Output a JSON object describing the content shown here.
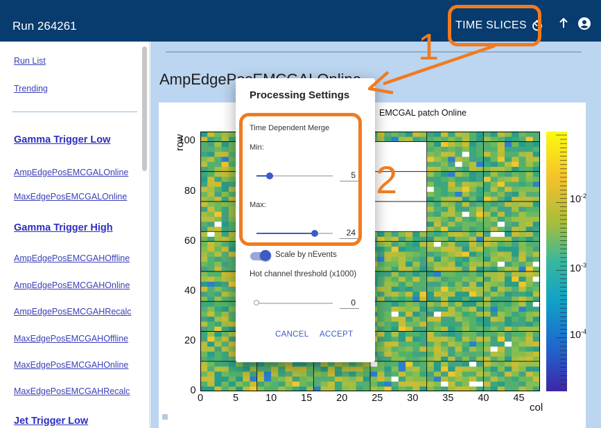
{
  "app": {
    "title": "Run 264261",
    "time_slices_label": "TIME SLICES"
  },
  "icons": {
    "timer": "timer-icon",
    "up": "arrow-up-icon",
    "account": "account-circle-icon"
  },
  "sidebar": {
    "links": [
      {
        "label": "Run List"
      },
      {
        "label": "Trending"
      }
    ],
    "groups": [
      {
        "heading": "Gamma Trigger Low",
        "items": [
          "AmpEdgePosEMCGALOnline",
          "MaxEdgePosEMCGALOnline"
        ]
      },
      {
        "heading": "Gamma Trigger High",
        "items": [
          "AmpEdgePosEMCGAHOffline",
          "AmpEdgePosEMCGAHOnline",
          "AmpEdgePosEMCGAHRecalc",
          "MaxEdgePosEMCGAHOffline",
          "MaxEdgePosEMCGAHOnline",
          "MaxEdgePosEMCGAHRecalc"
        ]
      },
      {
        "heading": "Jet Trigger Low",
        "items": []
      }
    ]
  },
  "main": {
    "title": "AmpEdgePosEMCGALOnline",
    "plot_title_visible": "EMCGAL patch Online"
  },
  "dialog": {
    "title": "Processing Settings",
    "merge_label": "Time Dependent Merge",
    "min_label": "Min:",
    "min_value": "5",
    "max_label": "Max:",
    "max_value": "24",
    "scale_label": "Scale by nEvents",
    "scale_enabled": true,
    "threshold_label": "Hot channel threshold (x1000)",
    "threshold_value": "0",
    "cancel_label": "CANCEL",
    "accept_label": "ACCEPT",
    "min_fraction": 0.17,
    "max_fraction": 0.76,
    "threshold_fraction": 0.0
  },
  "annotations": {
    "step1": "1",
    "step2": "2",
    "color": "#f07b1f"
  },
  "chart_data": {
    "type": "heatmap",
    "title": "EMCGAL patch Online",
    "xlabel": "col",
    "ylabel": "row",
    "xlim": [
      0,
      48
    ],
    "ylim": [
      0,
      104
    ],
    "x_ticks": [
      "0",
      "5",
      "10",
      "15",
      "20",
      "25",
      "30",
      "35",
      "40",
      "45"
    ],
    "y_ticks": [
      "0",
      "20",
      "40",
      "60",
      "80",
      "100"
    ],
    "colorbar": {
      "scale": "log",
      "tick_labels": [
        "10^-2",
        "10^-3",
        "10^-4"
      ],
      "colormap": "parula"
    },
    "colors": {
      "frame": "#000000",
      "empty_cell": "#ffffff"
    }
  }
}
